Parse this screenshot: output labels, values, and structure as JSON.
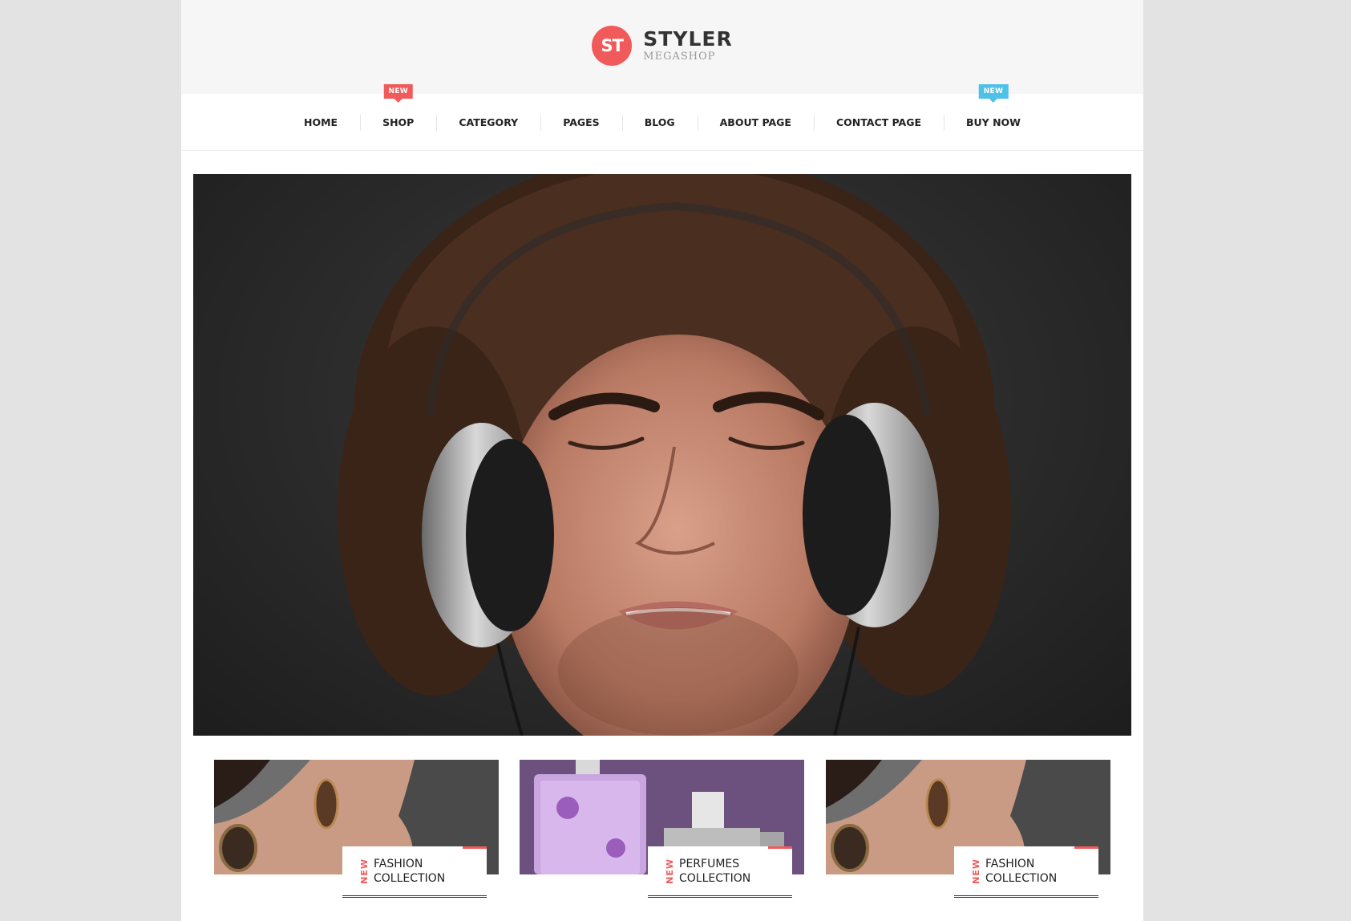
{
  "header": {
    "logo_mark": "ST",
    "logo_title": "STYLER",
    "logo_subtitle": "MEGASHOP"
  },
  "nav": {
    "items": [
      {
        "label": "HOME",
        "badge": ""
      },
      {
        "label": "SHOP",
        "badge": "NEW",
        "badge_color": "#f15a5a"
      },
      {
        "label": "CATEGORY",
        "badge": ""
      },
      {
        "label": "PAGES",
        "badge": ""
      },
      {
        "label": "BLOG",
        "badge": ""
      },
      {
        "label": "ABOUT PAGE",
        "badge": ""
      },
      {
        "label": "CONTACT PAGE",
        "badge": ""
      },
      {
        "label": "BUY NOW",
        "badge": "NEW",
        "badge_color": "#4fc1e9"
      }
    ]
  },
  "banners": [
    {
      "tag": "NEW",
      "line1": "FASHION",
      "line2": "COLLECTION",
      "image": "woman-earring"
    },
    {
      "tag": "NEW",
      "line1": "PERFUMES",
      "line2": "COLLECTION",
      "image": "perfume-bottles"
    },
    {
      "tag": "NEW",
      "line1": "FASHION",
      "line2": "COLLECTION",
      "image": "woman-earring"
    }
  ],
  "colors": {
    "accent": "#f15a5a",
    "accent_alt": "#4fc1e9",
    "background": "#e3e3e3"
  }
}
